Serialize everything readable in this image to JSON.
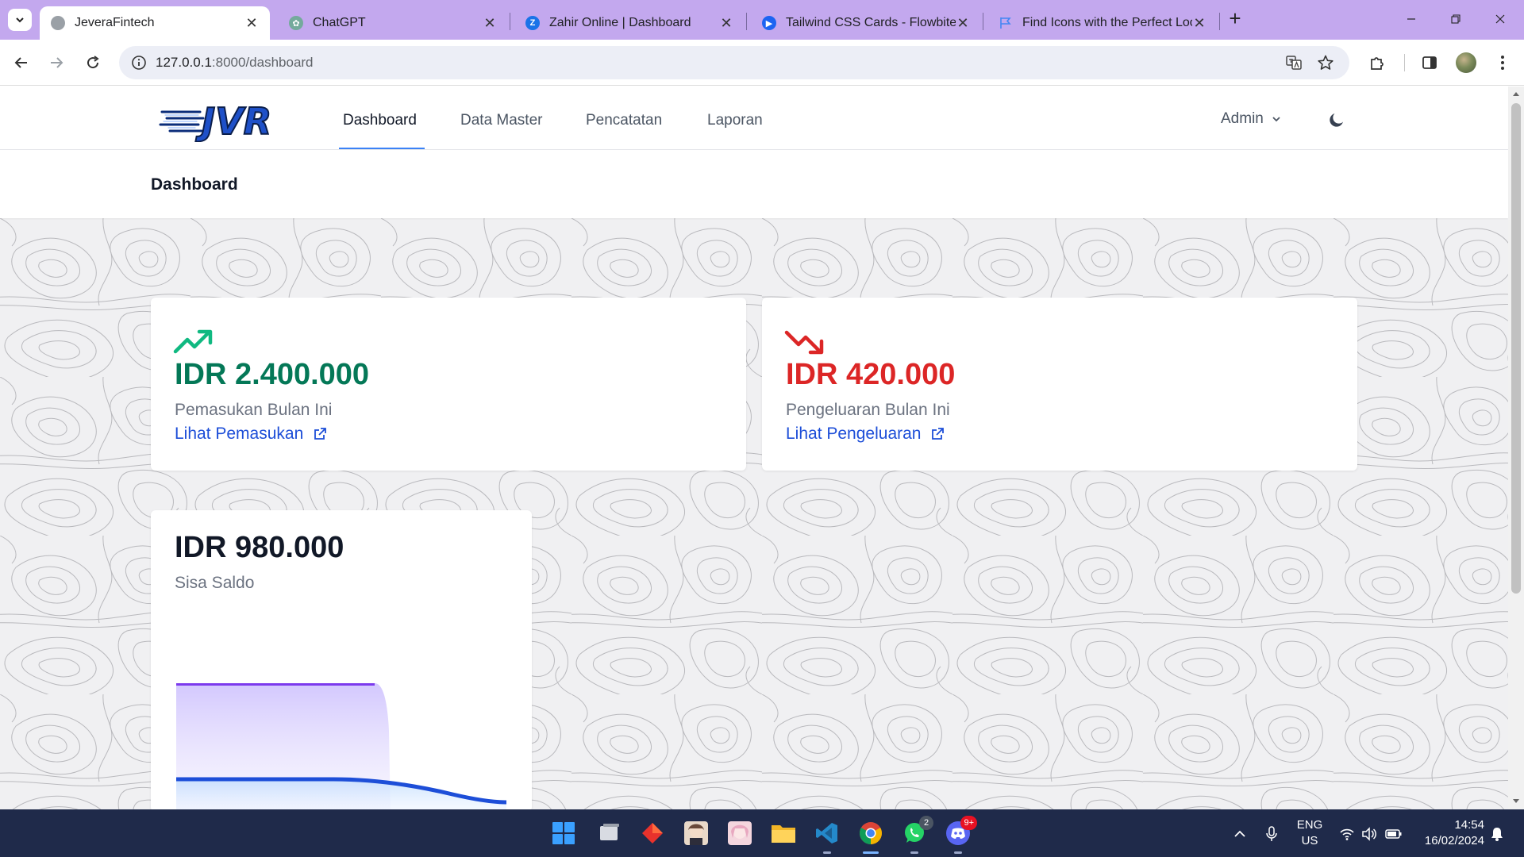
{
  "browser": {
    "tabs": [
      {
        "title": "JeveraFintech",
        "active": true
      },
      {
        "title": "ChatGPT",
        "active": false
      },
      {
        "title": "Zahir Online | Dashboard",
        "active": false
      },
      {
        "title": "Tailwind CSS Cards - Flowbite",
        "active": false
      },
      {
        "title": "Find Icons with the Perfect Look",
        "active": false
      }
    ],
    "url_host": "127.0.0.1",
    "url_rest": ":8000/dashboard"
  },
  "app": {
    "logo_text": "JVR",
    "nav": [
      {
        "label": "Dashboard",
        "active": true
      },
      {
        "label": "Data Master",
        "active": false
      },
      {
        "label": "Pencatatan",
        "active": false
      },
      {
        "label": "Laporan",
        "active": false
      }
    ],
    "user_menu": "Admin",
    "page_title": "Dashboard"
  },
  "cards": {
    "income": {
      "amount": "IDR 2.400.000",
      "label": "Pemasukan Bulan Ini",
      "link": "Lihat Pemasukan",
      "icon": "trending-up-icon",
      "color": "#047857",
      "icon_color": "#10b981"
    },
    "expense": {
      "amount": "IDR 420.000",
      "label": "Pengeluaran Bulan Ini",
      "link": "Lihat Pengeluaran",
      "icon": "trending-down-icon",
      "color": "#dc2626"
    },
    "balance": {
      "amount": "IDR 980.000",
      "label": "Sisa Saldo",
      "chart_colors": {
        "purple": "#7c3aed",
        "blue": "#1d4ed8"
      }
    }
  },
  "taskbar": {
    "apps": [
      "start",
      "task-view",
      "app-red",
      "app-anime-1",
      "app-anime-2",
      "file-explorer",
      "vscode",
      "chrome",
      "whatsapp",
      "discord"
    ],
    "whatsapp_badge": "2",
    "discord_badge": "9+",
    "lang_top": "ENG",
    "lang_bottom": "US",
    "time": "14:54",
    "date": "16/02/2024"
  }
}
